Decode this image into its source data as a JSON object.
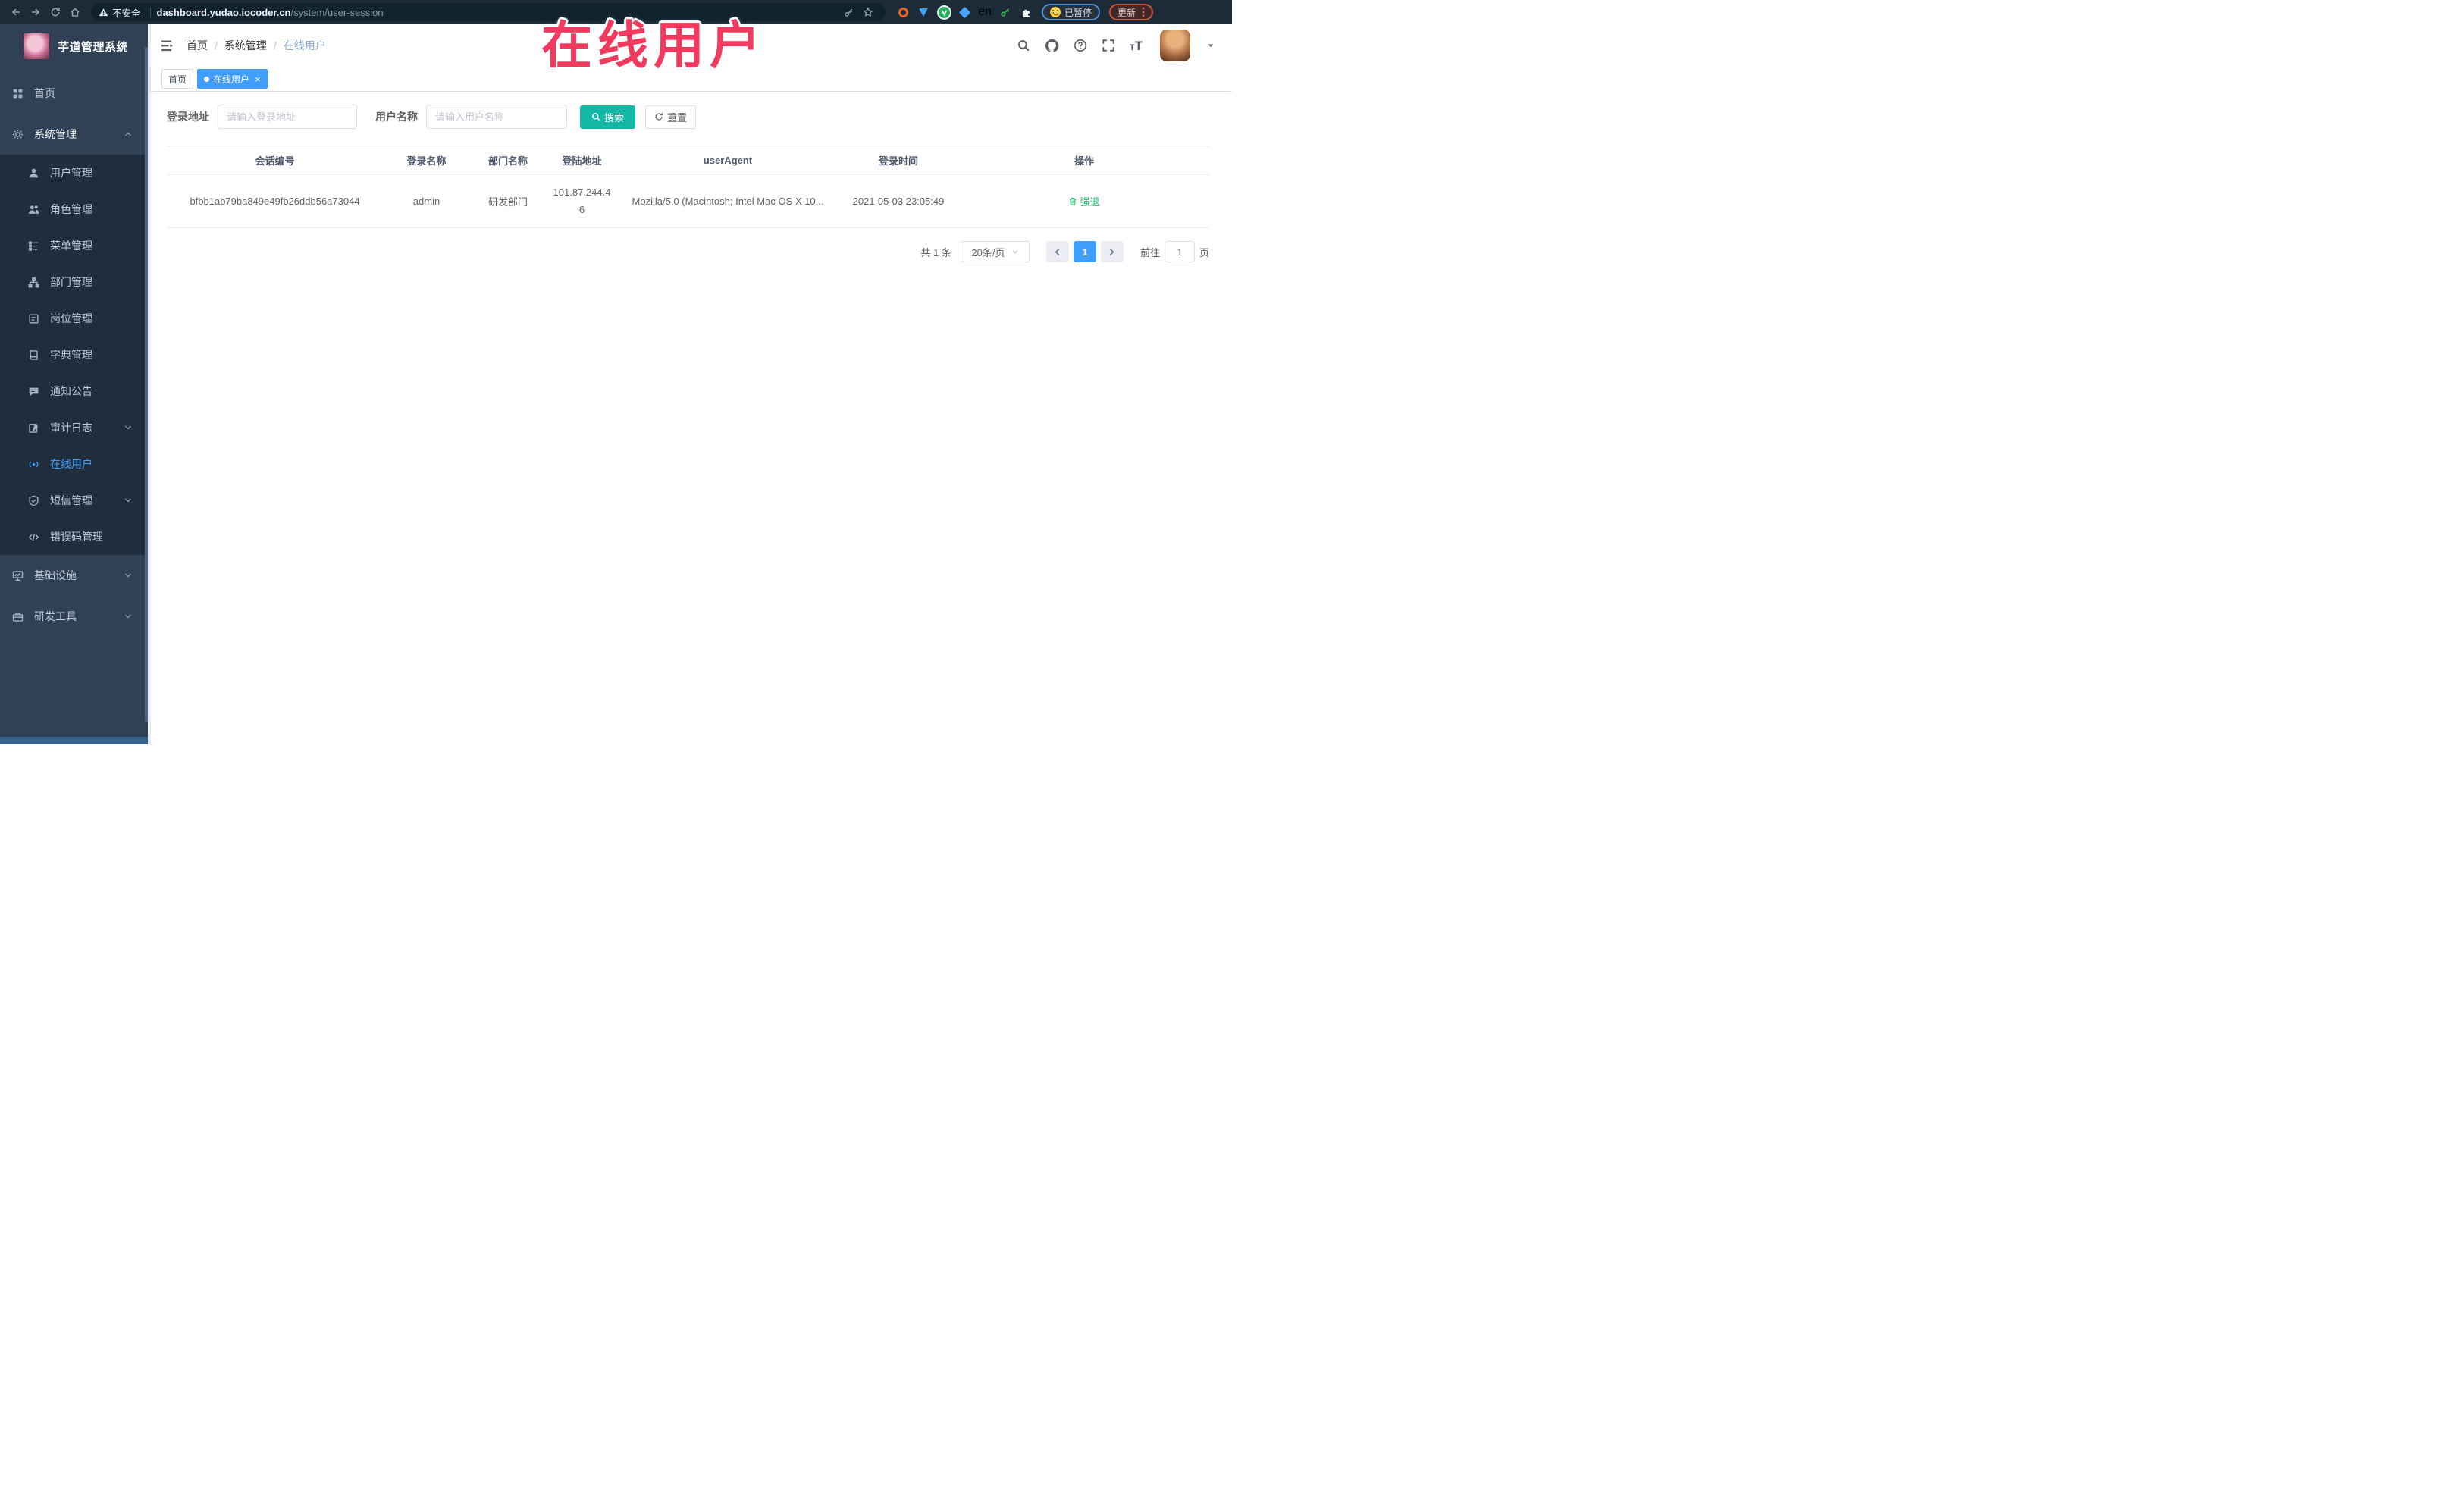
{
  "colors": {
    "accent_blue": "#409eff",
    "search_button_teal": "#14b8a6",
    "action_green": "#19be6b",
    "annotation_red": "#f23a5e",
    "sidebar_bg": "#304156",
    "submenu_bg": "#1f2d3d",
    "active_tab_bg": "#409eff"
  },
  "browser": {
    "security_label": "不安全",
    "url_domain": "dashboard.yudao.iocoder.cn",
    "url_path": "/system/user-session",
    "extension_en_badge": "en",
    "paused_badge": "已暂停",
    "update_button": "更新"
  },
  "annotation": {
    "text": "在线用户"
  },
  "sidebar": {
    "logo_title": "芋道管理系统",
    "menu": [
      {
        "label": "首页",
        "icon": "home-icon",
        "level": 1
      },
      {
        "label": "系统管理",
        "icon": "gear-icon",
        "level": 1,
        "chevron": "up",
        "open": true
      },
      {
        "label": "用户管理",
        "icon": "user-icon",
        "level": 2
      },
      {
        "label": "角色管理",
        "icon": "roles-icon",
        "level": 2
      },
      {
        "label": "菜单管理",
        "icon": "menu-list-icon",
        "level": 2
      },
      {
        "label": "部门管理",
        "icon": "org-tree-icon",
        "level": 2
      },
      {
        "label": "岗位管理",
        "icon": "post-icon",
        "level": 2
      },
      {
        "label": "字典管理",
        "icon": "dict-icon",
        "level": 2
      },
      {
        "label": "通知公告",
        "icon": "notice-icon",
        "level": 2
      },
      {
        "label": "审计日志",
        "icon": "audit-log-icon",
        "level": 2,
        "chevron": "down"
      },
      {
        "label": "在线用户",
        "icon": "online-user-icon",
        "level": 2,
        "active": true
      },
      {
        "label": "短信管理",
        "icon": "sms-icon",
        "level": 2,
        "chevron": "down"
      },
      {
        "label": "错误码管理",
        "icon": "error-code-icon",
        "level": 2
      },
      {
        "label": "基础设施",
        "icon": "infra-icon",
        "level": 1,
        "chevron": "down"
      },
      {
        "label": "研发工具",
        "icon": "devtool-icon",
        "level": 1,
        "chevron": "down"
      }
    ]
  },
  "breadcrumb": {
    "items": [
      {
        "label": "首页",
        "current": false
      },
      {
        "label": "系统管理",
        "current": false
      },
      {
        "label": "在线用户",
        "current": true
      }
    ]
  },
  "tabs": [
    {
      "label": "首页",
      "active": false,
      "closable": false
    },
    {
      "label": "在线用户",
      "active": true,
      "closable": true
    }
  ],
  "filters": {
    "login_address_label": "登录地址",
    "login_address_placeholder": "请输入登录地址",
    "login_address_value": "",
    "username_label": "用户名称",
    "username_placeholder": "请输入用户名称",
    "username_value": "",
    "search_label": "搜索",
    "reset_label": "重置"
  },
  "table": {
    "columns": [
      "会话编号",
      "登录名称",
      "部门名称",
      "登陆地址",
      "userAgent",
      "登录时间",
      "操作"
    ],
    "fields": [
      "session_id",
      "login_name",
      "dept_name",
      "login_ip",
      "user_agent",
      "login_time",
      "action_label"
    ],
    "rows": [
      {
        "session_id": "bfbb1ab79ba849e49fb26ddb56a73044",
        "login_name": "admin",
        "dept_name": "研发部门",
        "login_ip": "101.87.244.46",
        "user_agent": "Mozilla/5.0 (Macintosh; Intel Mac OS X 10...",
        "login_time": "2021-05-03 23:05:49",
        "action_label": "强退"
      }
    ]
  },
  "pagination": {
    "total_label": "共 1 条",
    "page_size_label": "20条/页",
    "current_page": "1",
    "goto_label": "前往",
    "goto_value": "1",
    "page_unit_label": "页"
  }
}
